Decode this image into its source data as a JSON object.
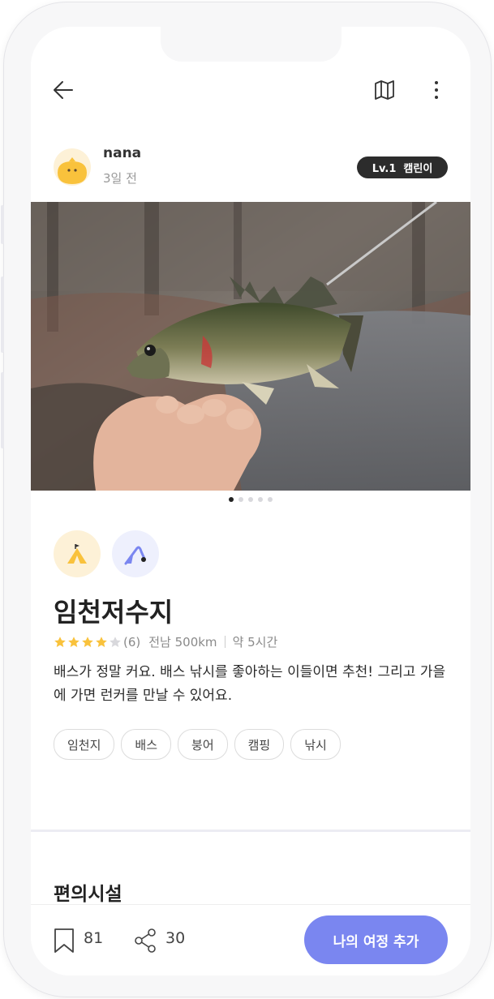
{
  "header": {
    "back_icon": "arrow-left-icon",
    "map_icon": "map-icon",
    "more_icon": "more-vertical-icon"
  },
  "author": {
    "name": "nana",
    "posted": "3일 전",
    "level_badge": "Lv.1  캠린이"
  },
  "photo": {
    "page_count": 5,
    "active_index": 0
  },
  "category_icons": [
    "camping-tent-icon",
    "fishing-rod-icon"
  ],
  "spot": {
    "title": "임천저수지",
    "rating": 4,
    "rating_max": 5,
    "review_count": "(6)",
    "region": "전남 500km",
    "duration": "약 5시간",
    "description": "배스가 정말 커요. 배스 낚시를 좋아하는 이들이면 추천! 그리고 가을에 가면 런커를 만날 수 있어요.",
    "tags": [
      "임천지",
      "배스",
      "붕어",
      "캠핑",
      "낚시"
    ]
  },
  "facilities": {
    "title": "편의시설"
  },
  "bottom_bar": {
    "bookmark_count": "81",
    "share_count": "30",
    "cta_label": "나의 여정 추가"
  },
  "colors": {
    "accent": "#7a86f0",
    "star": "#f9c23c",
    "star_empty": "#d8d8dc",
    "badge_bg": "#2c2c2c"
  }
}
